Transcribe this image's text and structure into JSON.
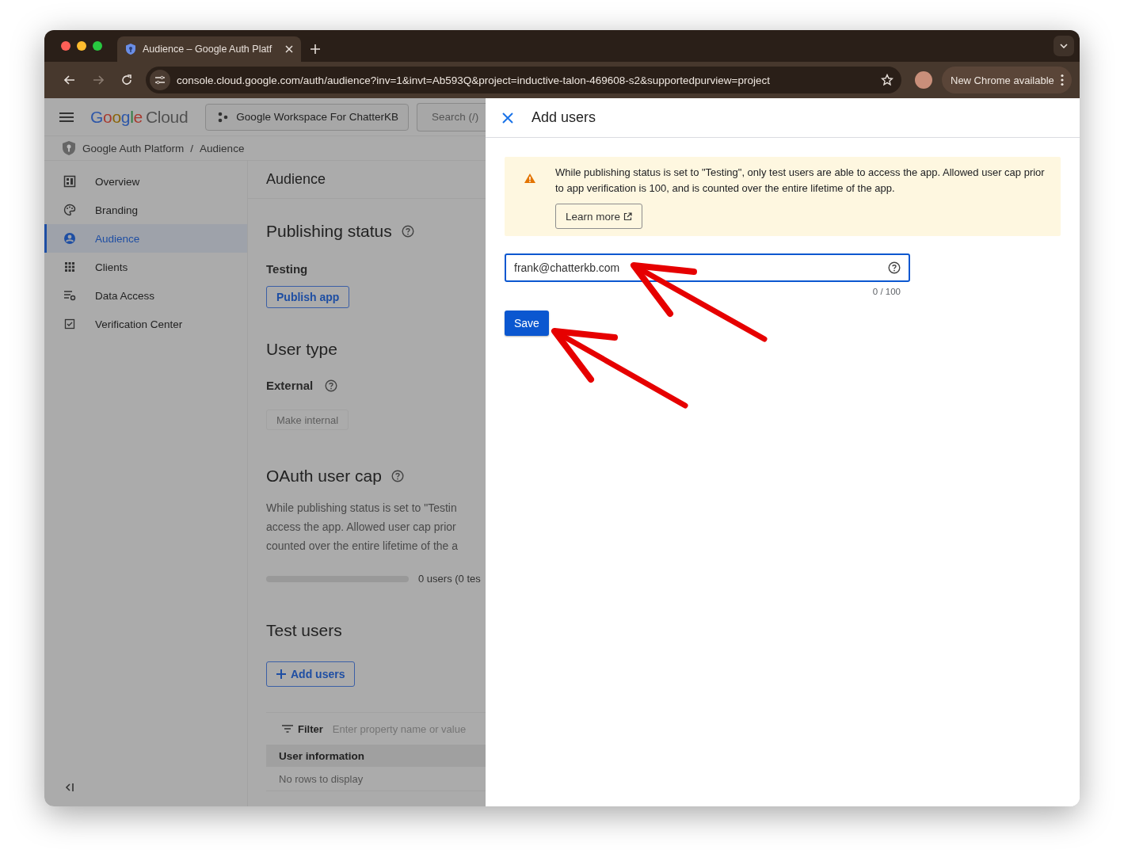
{
  "browser": {
    "tab": {
      "title": "Audience – Google Auth Platf",
      "selected": true
    },
    "url": "console.cloud.google.com/auth/audience?inv=1&invt=Ab593Q&project=inductive-talon-469608-s2&supportedpurview=project",
    "update_button": "New Chrome available"
  },
  "header": {
    "logo": {
      "google": "Google",
      "cloud": "Cloud"
    },
    "project": "Google Workspace For ChatterKB",
    "search_placeholder": "Search (/)"
  },
  "breadcrumb": {
    "items": [
      "Google Auth Platform",
      "Audience"
    ],
    "separator": "/"
  },
  "sidebar": {
    "items": [
      {
        "label": "Overview",
        "selected": false
      },
      {
        "label": "Branding",
        "selected": false
      },
      {
        "label": "Audience",
        "selected": true
      },
      {
        "label": "Clients",
        "selected": false
      },
      {
        "label": "Data Access",
        "selected": false
      },
      {
        "label": "Verification Center",
        "selected": false
      }
    ]
  },
  "page": {
    "title": "Audience",
    "publishing": {
      "heading": "Publishing status",
      "status": "Testing",
      "button": "Publish app"
    },
    "user_type": {
      "heading": "User type",
      "type": "External",
      "button": {
        "label": "Make internal",
        "disabled": true
      }
    },
    "user_cap": {
      "heading": "OAuth user cap",
      "lines": [
        "While publishing status is set to \"Testin",
        "access the app. Allowed user cap prior",
        "counted over the entire lifetime of the a"
      ],
      "level": 0,
      "reading": "0 users (0 tes"
    },
    "test_users": {
      "heading": "Test users",
      "button": "Add users",
      "filter_label": "Filter",
      "filter_placeholder": "Enter property name or value",
      "columns": [
        "User information"
      ],
      "empty": "No rows to display"
    }
  },
  "drawer": {
    "title": "Add users",
    "notice": {
      "text": "While publishing status is set to \"Testing\", only test users are able to access the app. Allowed user cap prior to app verification is 100, and is counted over the entire lifetime of the app.",
      "button": "Learn more"
    },
    "field": {
      "value": "frank@chatterkb.com"
    },
    "counter": "0 / 100",
    "save": "Save"
  }
}
